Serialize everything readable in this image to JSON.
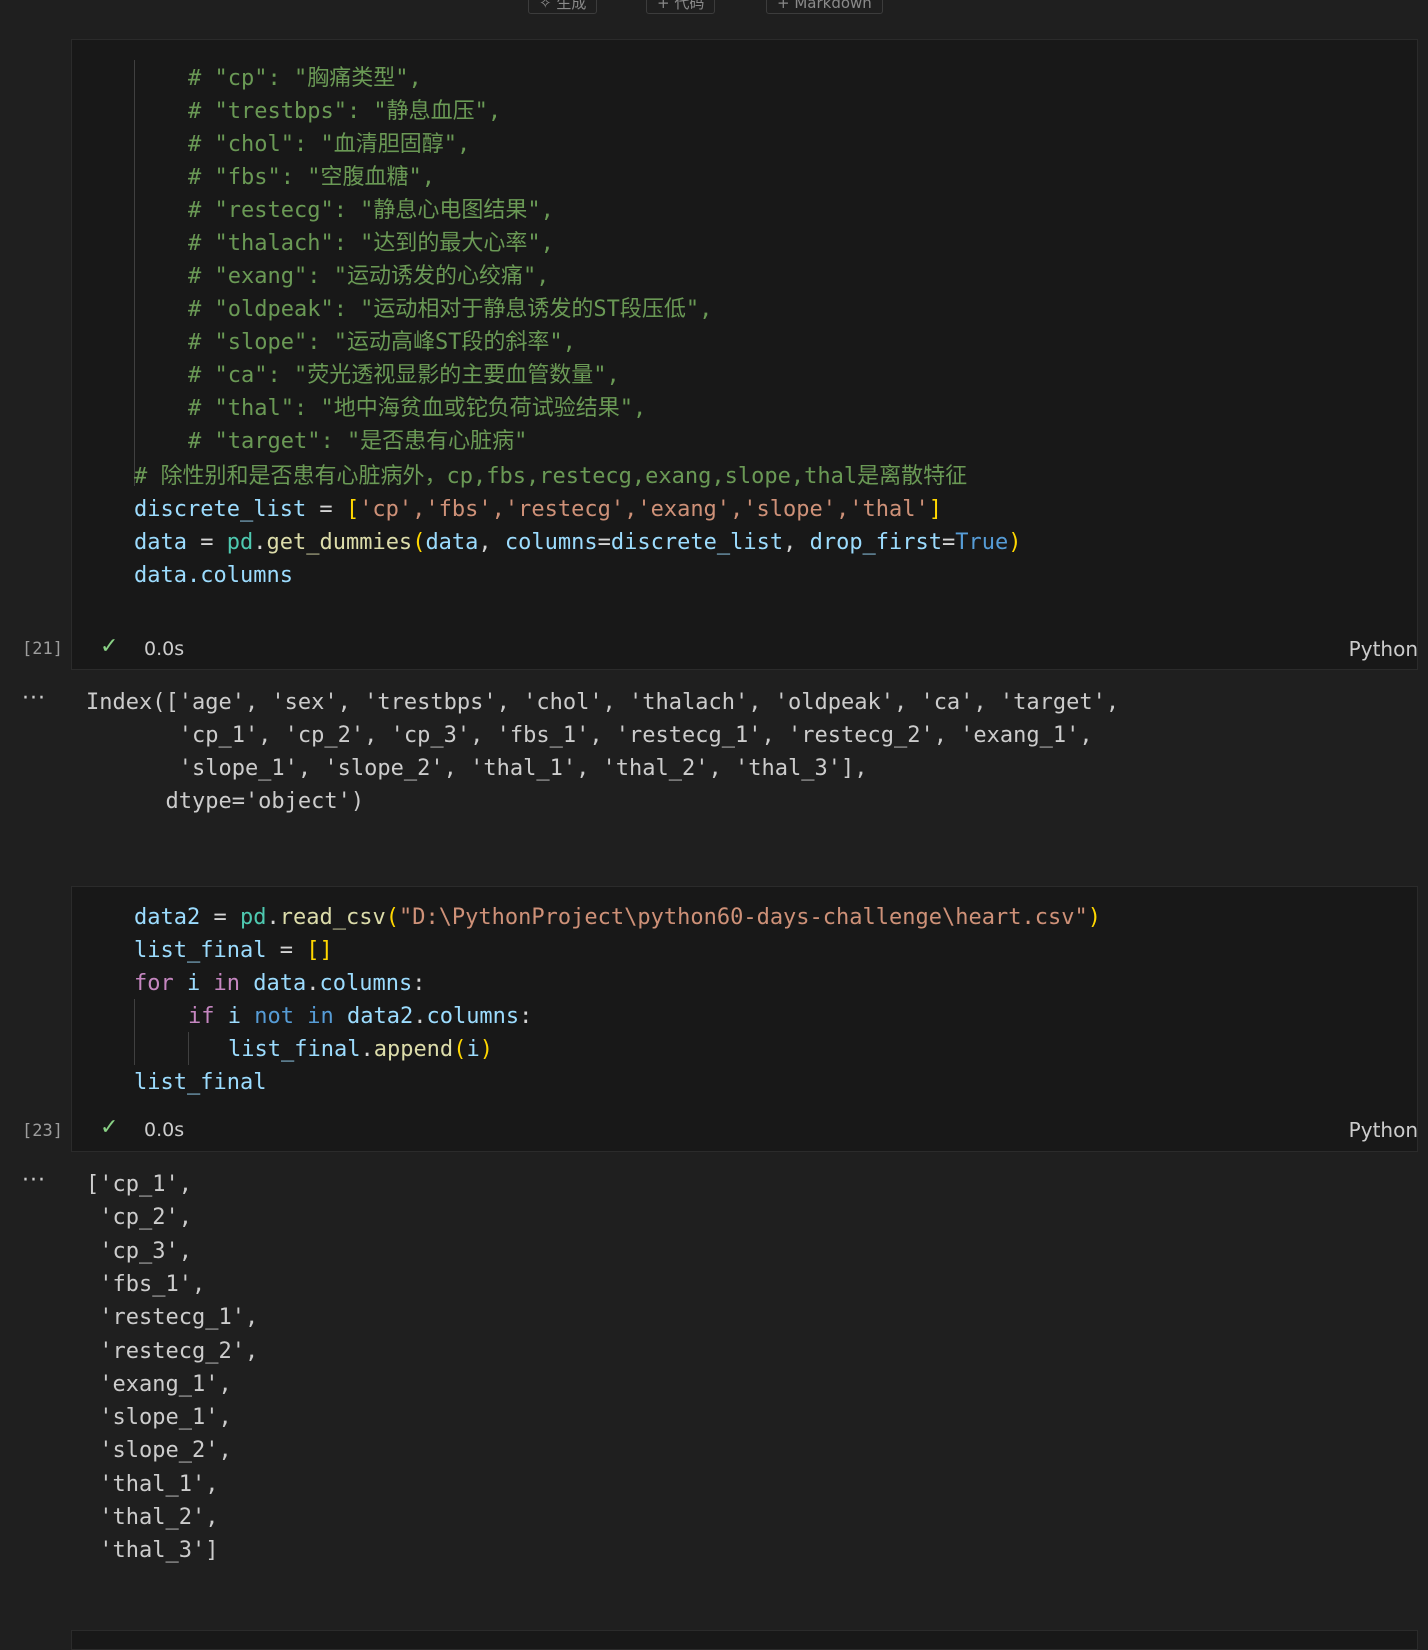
{
  "toolbar": {
    "generate_label": "生成",
    "code_label": "代码",
    "markdown_label": "Markdown"
  },
  "cell1": {
    "comment_lines": [
      "# \"cp\": \"胸痛类型\",",
      "# \"trestbps\": \"静息血压\",",
      "# \"chol\": \"血清胆固醇\",",
      "# \"fbs\": \"空腹血糖\",",
      "# \"restecg\": \"静息心电图结果\",",
      "# \"thalach\": \"达到的最大心率\",",
      "# \"exang\": \"运动诱发的心绞痛\",",
      "# \"oldpeak\": \"运动相对于静息诱发的ST段压低\",",
      "# \"slope\": \"运动高峰ST段的斜率\",",
      "# \"ca\": \"荧光透视显影的主要血管数量\",",
      "# \"thal\": \"地中海贫血或铊负荷试验结果\",",
      "# \"target\": \"是否患有心脏病\""
    ],
    "comment_main": "# 除性别和是否患有心脏病外，cp,fbs,restecg,exang,slope,thal是离散特征",
    "line_discrete": {
      "var": "discrete_list",
      "eq": " = ",
      "open": "[",
      "items": "'cp','fbs','restecg','exang','slope','thal'",
      "close": "]"
    },
    "line_dummies": {
      "var": "data",
      "eq": " = ",
      "mod": "pd",
      "dot": ".",
      "fn": "get_dummies",
      "open": "(",
      "arg1": "data",
      "sep1": ", ",
      "kw1": "columns",
      "eq1": "=",
      "arg2": "discrete_list",
      "sep2": ", ",
      "kw2": "drop_first",
      "eq2": "=",
      "val": "True",
      "close": ")"
    },
    "line_columns": "data.columns",
    "exec_count": "[21]",
    "status_check": "✓",
    "duration": "0.0s",
    "language": "Python",
    "output_ellipsis": "···",
    "output_lines": [
      "Index(['age', 'sex', 'trestbps', 'chol', 'thalach', 'oldpeak', 'ca', 'target',",
      "       'cp_1', 'cp_2', 'cp_3', 'fbs_1', 'restecg_1', 'restecg_2', 'exang_1',",
      "       'slope_1', 'slope_2', 'thal_1', 'thal_2', 'thal_3'],",
      "      dtype='object')"
    ]
  },
  "cell2": {
    "line1": {
      "var": "data2",
      "eq": " = ",
      "mod": "pd",
      "dot": ".",
      "fn": "read_csv",
      "open": "(",
      "str": "\"D:\\PythonProject\\python60-days-challenge\\heart.csv\"",
      "close": ")"
    },
    "line2": {
      "var": "list_final",
      "eq": " = ",
      "val": "[]"
    },
    "line3": {
      "kw": "for",
      "sp1": " ",
      "var": "i",
      "kw2": " in ",
      "obj": "data",
      "dot": ".",
      "attr": "columns",
      "colon": ":"
    },
    "line4": {
      "kw": "if",
      "sp1": " ",
      "var": "i",
      "kw2": " not in ",
      "obj": "data2",
      "dot": ".",
      "attr": "columns",
      "colon": ":"
    },
    "line5": {
      "obj": "list_final",
      "dot": ".",
      "fn": "append",
      "open": "(",
      "arg": "i",
      "close": ")"
    },
    "line6": "list_final",
    "exec_count": "[23]",
    "status_check": "✓",
    "duration": "0.0s",
    "language": "Python",
    "output_ellipsis": "···",
    "output_lines": [
      "['cp_1',",
      " 'cp_2',",
      " 'cp_3',",
      " 'fbs_1',",
      " 'restecg_1',",
      " 'restecg_2',",
      " 'exang_1',",
      " 'slope_1',",
      " 'slope_2',",
      " 'thal_1',",
      " 'thal_2',",
      " 'thal_3']"
    ]
  }
}
